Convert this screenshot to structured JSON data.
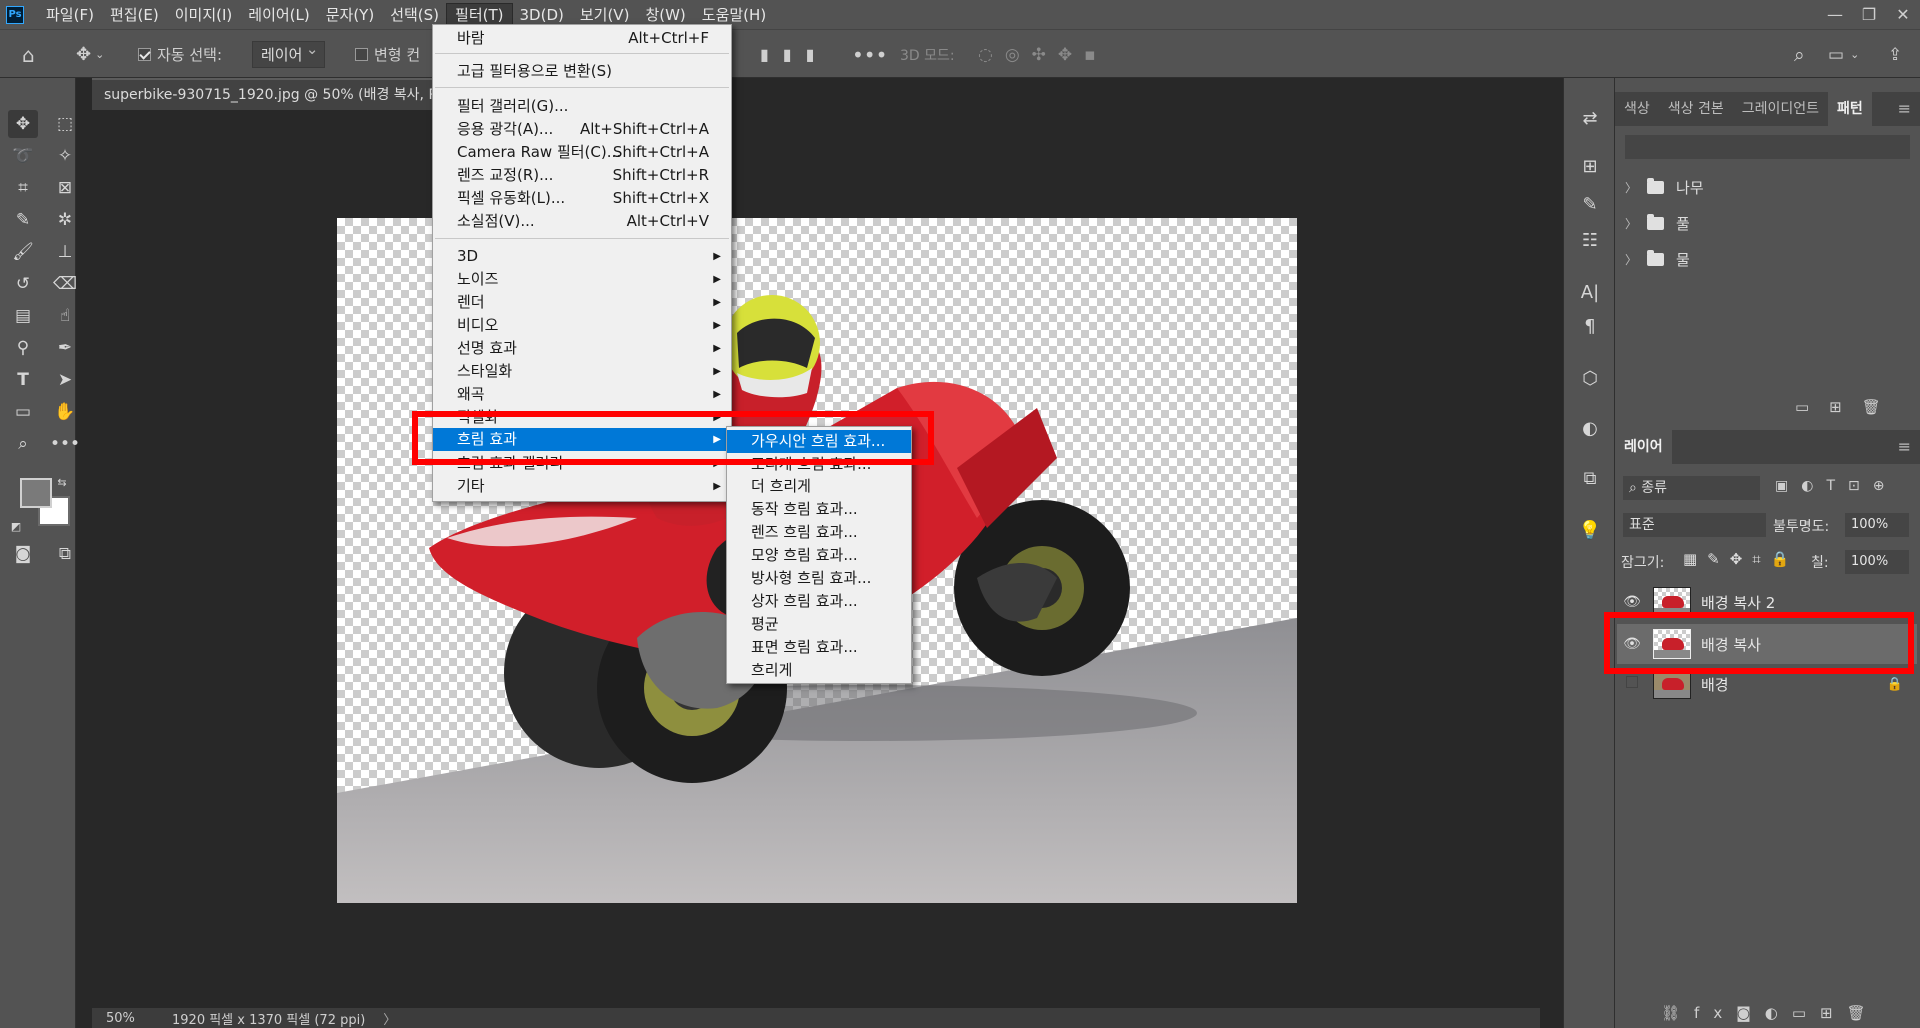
{
  "menubar": {
    "logo": "Ps",
    "items": [
      "파일(F)",
      "편집(E)",
      "이미지(I)",
      "레이어(L)",
      "문자(Y)",
      "선택(S)",
      "필터(T)",
      "3D(D)",
      "보기(V)",
      "창(W)",
      "도움말(H)"
    ],
    "active_index": 6
  },
  "options": {
    "auto_select_label": "자동 선택:",
    "auto_select_value": "레이어",
    "transform_label": "변형 컨",
    "mode_3d_label": "3D 모드:"
  },
  "document": {
    "tab_title": "superbike-930715_1920.jpg @ 50% (배경 복사, RGB",
    "status_zoom": "50%",
    "status_info": "1920 픽셀 x 1370 픽셀 (72 ppi)"
  },
  "filter_menu": {
    "items": [
      {
        "label": "바람",
        "shortcut": "Alt+Ctrl+F"
      },
      {
        "label": "고급 필터용으로 변환(S)",
        "shortcut": ""
      },
      {
        "label": "필터 갤러리(G)...",
        "shortcut": ""
      },
      {
        "label": "응용 광각(A)...",
        "shortcut": "Alt+Shift+Ctrl+A"
      },
      {
        "label": "Camera Raw 필터(C)...",
        "shortcut": "Shift+Ctrl+A"
      },
      {
        "label": "렌즈 교정(R)...",
        "shortcut": "Shift+Ctrl+R"
      },
      {
        "label": "픽셀 유동화(L)...",
        "shortcut": "Shift+Ctrl+X"
      },
      {
        "label": "소실점(V)...",
        "shortcut": "Alt+Ctrl+V"
      },
      {
        "label": "3D",
        "shortcut": ""
      },
      {
        "label": "노이즈",
        "shortcut": ""
      },
      {
        "label": "렌더",
        "shortcut": ""
      },
      {
        "label": "비디오",
        "shortcut": ""
      },
      {
        "label": "선명 효과",
        "shortcut": ""
      },
      {
        "label": "스타일화",
        "shortcut": ""
      },
      {
        "label": "왜곡",
        "shortcut": ""
      },
      {
        "label": "픽셀화",
        "shortcut": ""
      },
      {
        "label": "흐림 효과",
        "shortcut": ""
      },
      {
        "label": "흐림 효과 갤러리",
        "shortcut": ""
      },
      {
        "label": "기타",
        "shortcut": ""
      }
    ]
  },
  "blur_submenu": {
    "items": [
      "가우시안 흐림 효과...",
      "조리개 흐림 효과...",
      "더 흐리게",
      "동작 흐림 효과...",
      "렌즈 흐림 효과...",
      "모양 흐림 효과...",
      "방사형 흐림 효과...",
      "상자 흐림 효과...",
      "평균",
      "표면 흐림 효과...",
      "흐리게"
    ]
  },
  "pattern_panel": {
    "tabs": [
      "색상",
      "색상 견본",
      "그레이디언트",
      "패턴"
    ],
    "active_tab": 3,
    "folders": [
      "나무",
      "풀",
      "물"
    ]
  },
  "layers_panel": {
    "title": "레이어",
    "filter_label": "종류",
    "blend_mode": "표준",
    "opacity_label": "불투명도:",
    "opacity_value": "100%",
    "lock_label": "잠그기:",
    "fill_label": "칠:",
    "fill_value": "100%",
    "layers": [
      {
        "name": "배경 복사 2",
        "visible": true,
        "selected": false,
        "locked": false
      },
      {
        "name": "배경 복사",
        "visible": true,
        "selected": true,
        "locked": false
      },
      {
        "name": "배경",
        "visible": false,
        "selected": false,
        "locked": true
      }
    ]
  },
  "colors": {
    "highlight": "#0078d7",
    "annotation": "#ff0000"
  }
}
